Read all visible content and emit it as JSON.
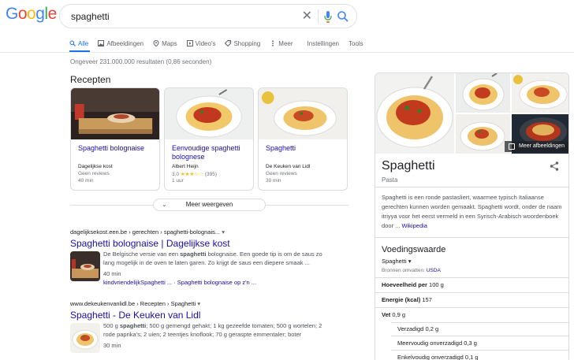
{
  "logo": {
    "letters": [
      "G",
      "o",
      "o",
      "g",
      "l",
      "e"
    ]
  },
  "search": {
    "query": "spaghetti",
    "clear_icon": "close-icon",
    "mic_icon": "mic-icon",
    "search_icon": "search-icon"
  },
  "tabs": [
    {
      "label": "Alle",
      "icon": "search-icon",
      "active": true
    },
    {
      "label": "Afbeeldingen",
      "icon": "image-icon",
      "active": false
    },
    {
      "label": "Maps",
      "icon": "map-pin-icon",
      "active": false
    },
    {
      "label": "Video's",
      "icon": "video-icon",
      "active": false
    },
    {
      "label": "Shopping",
      "icon": "tag-icon",
      "active": false
    },
    {
      "label": "Meer",
      "icon": "more-icon",
      "active": false
    },
    {
      "label": "Instellingen",
      "icon": "",
      "active": false
    },
    {
      "label": "Tools",
      "icon": "",
      "active": false
    }
  ],
  "stats": "Ongeveer 231.000.000 resultaten (0,86 seconden)",
  "recipes": {
    "title": "Recepten",
    "cards": [
      {
        "title": "Spaghetti bolognaise",
        "source": "Dagelijkse kost",
        "reviews": "Geen reviews",
        "time": "40 min"
      },
      {
        "title": "Eenvoudige spaghetti bolognese",
        "source": "Albert Heijn",
        "rating": "3,0",
        "stars": "★★★☆☆",
        "count": "(395)",
        "time": "1 uur"
      },
      {
        "title": "Spaghetti",
        "source": "De Keuken van Lidl",
        "reviews": "Geen reviews",
        "time": "30 min"
      }
    ],
    "more_label": "Meer weergeven"
  },
  "results": [
    {
      "cite": "dagelijksekost.een.be › gerechten › spaghetti-bolognais...",
      "title": "Spaghetti bolognaise | Dagelijkse kost",
      "snippet_parts": [
        "De Belgische versie van een ",
        "spaghetti",
        " bolognaise. Een goede tip is om de saus zo lang mogelijk in de oven te laten garen. Zo krijgt de saus een diepere smaak ..."
      ],
      "time": "40 min",
      "sitelinks": "kindvriendelijkSpaghetti ... · Spaghetti bolognaise op z'n ..."
    },
    {
      "cite": "www.dekeukenvanlidl.be › Recepten › Spaghetti",
      "title": "Spaghetti - De Keuken van Lidl",
      "snippet_parts": [
        "500 g ",
        "spaghetti",
        "; 500 g gemengd gehakt; 1 kg gezeefde tomaten; 500 g wortelen; 2 rode paprika's; 2 uien; 2 teentjes knoflook; 70 g geraspte emmentaler; boter"
      ],
      "time": "30 min"
    }
  ],
  "knowledge_panel": {
    "more_images": "Meer afbeeldingen",
    "title": "Spaghetti",
    "subtitle": "Pasta",
    "description": "Spaghetti is een ronde pastasliert, waarmee typisch Italiaanse gerechten kunnen worden gemaakt. Spaghetti wordt, onder de naam itriyya voor het eerst vermeld in een Syrisch-Arabisch woordenboek door ... ",
    "wiki_link": "Wikipedia",
    "nutrition_title": "Voedingswaarde",
    "nutrition_select": "Spaghetti",
    "source_prefix": "Bronnen omvatten: ",
    "source_link": "USDA",
    "rows": [
      {
        "label": "Hoeveelheid per",
        "value": "100 g",
        "bold": true,
        "indent": false
      },
      {
        "label": "Energie (kcal)",
        "value": "157",
        "bold": true,
        "indent": false
      },
      {
        "label": "Vet",
        "value": "0,9 g",
        "bold": true,
        "indent": false
      },
      {
        "label": "Verzadigd",
        "value": "0,2 g",
        "bold": false,
        "indent": true
      },
      {
        "label": "Meervoudig onverzadigd",
        "value": "0,3 g",
        "bold": false,
        "indent": true
      },
      {
        "label": "Enkelvoudig onverzadigd",
        "value": "0,1 g",
        "bold": false,
        "indent": true
      }
    ]
  },
  "colors": {
    "link": "#1a0dab",
    "accent": "#1a73e8",
    "text": "#202124",
    "muted": "#70757a"
  }
}
